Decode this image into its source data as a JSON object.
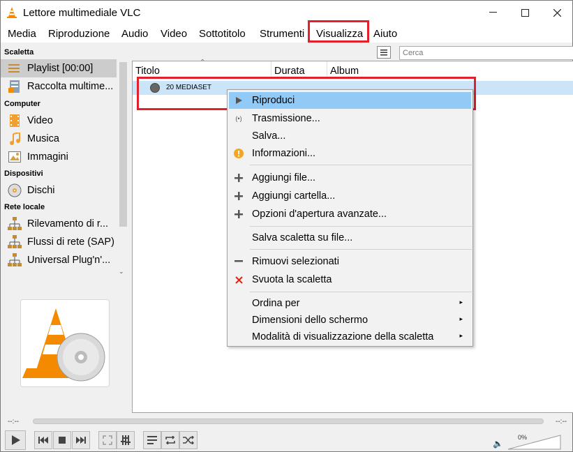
{
  "window": {
    "title": "Lettore multimediale VLC"
  },
  "menubar": {
    "items": [
      "Media",
      "Riproduzione",
      "Audio",
      "Video",
      "Sottotitolo",
      "Strumenti",
      "Visualizza",
      "Aiuto"
    ]
  },
  "sidebar": {
    "sections": {
      "scaletta": "Scaletta",
      "computer": "Computer",
      "dispositivi": "Dispositivi",
      "rete": "Rete locale"
    },
    "items": {
      "playlist": "Playlist [00:00]",
      "raccolta": "Raccolta multime...",
      "video": "Video",
      "musica": "Musica",
      "immagini": "Immagini",
      "dischi": "Dischi",
      "rilevamento": "Rilevamento di r...",
      "flussi": "Flussi di rete (SAP)",
      "upnp": "Universal Plug'n'..."
    }
  },
  "search": {
    "placeholder": "Cerca"
  },
  "playlist": {
    "columns": [
      "Titolo",
      "Durata",
      "Album"
    ],
    "rows": [
      {
        "title": "20 MEDIASET"
      }
    ]
  },
  "context_menu": {
    "items": {
      "riproduci": "Riproduci",
      "trasmissione": "Trasmissione...",
      "salva": "Salva...",
      "informazioni": "Informazioni...",
      "aggiungi_file": "Aggiungi file...",
      "aggiungi_cartella": "Aggiungi cartella...",
      "opzioni": "Opzioni d'apertura avanzate...",
      "salva_scaletta": "Salva scaletta su file...",
      "rimuovi": "Rimuovi selezionati",
      "svuota": "Svuota la scaletta",
      "ordina": "Ordina per",
      "dimensioni": "Dimensioni dello schermo",
      "modalita": "Modalità di visualizzazione della scaletta"
    }
  },
  "controls": {
    "time_elapsed": "--:--",
    "time_total": "--:--",
    "volume": "0%"
  },
  "colors": {
    "highlight_box": "#e0202a",
    "menu_active": "#91c9f7",
    "row_selected": "#cce4f7",
    "vlc_orange": "#f48a00"
  }
}
